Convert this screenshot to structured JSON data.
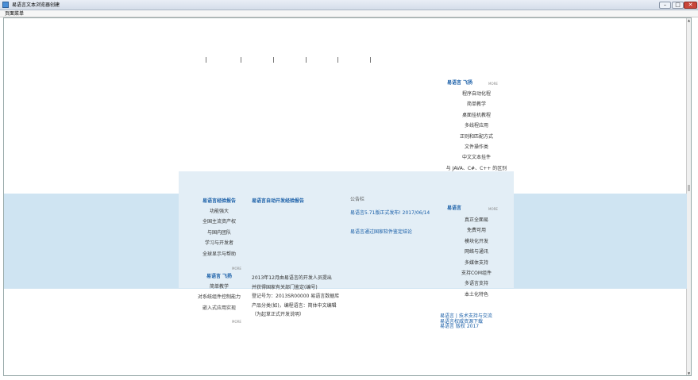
{
  "window": {
    "title": "易语言文本浏览器创建",
    "minimize": "–",
    "maximize": "□",
    "close": "✕"
  },
  "menu": {
    "items": [
      "页面菜单"
    ]
  },
  "right_top": {
    "heading": "易语言 飞扬",
    "more": "MORE",
    "items": [
      "程序自动化程",
      "简单教学",
      "桌面挂机教程",
      "多线程应用",
      "正则和匹配方式",
      "文件操作类",
      "中文文本挂件",
      "与 JAVA、C#、C++ 的区别"
    ]
  },
  "left_col1": {
    "heading": "易语言经验报告",
    "items": [
      "功能强大",
      "全国主流资产权",
      "与国内团队",
      "学习与开发者",
      "全球显示与帮助"
    ],
    "more": "MORE"
  },
  "left_col2": {
    "heading": "易语言 飞扬",
    "items": [
      "简单教学",
      "对系统组件控制能力",
      "嵌入式应用实现"
    ],
    "more": "MORE"
  },
  "mid_col": {
    "heading": "易语言自动开发经验报告",
    "lines": [
      "2013年12月由易语言的开发人员提出",
      "并获得国家有关部门鉴定(编号)",
      "登记号为：2013SR00000 易语言数据库",
      "产品分类(如)，编程语言：简体中文编辑",
      "（为起草正式开发说明）"
    ]
  },
  "news": {
    "label": "公告栏",
    "items": [
      "易语言5.71版正式发布! 2017/06/14",
      "易语言通过国家软件鉴定结论"
    ]
  },
  "right_bottom": {
    "heading": "易语言",
    "more": "MORE",
    "items": [
      "真正全面易",
      "免费可用",
      "模块化开发",
      "网络与通讯",
      "多媒体支持",
      "支持COM组件",
      "多语言支持",
      "本土化特色"
    ]
  },
  "footer": {
    "lines": [
      "易语言 | 技术支持与交流",
      "易语言权威资源下载",
      "易语言 版权 2017"
    ]
  }
}
